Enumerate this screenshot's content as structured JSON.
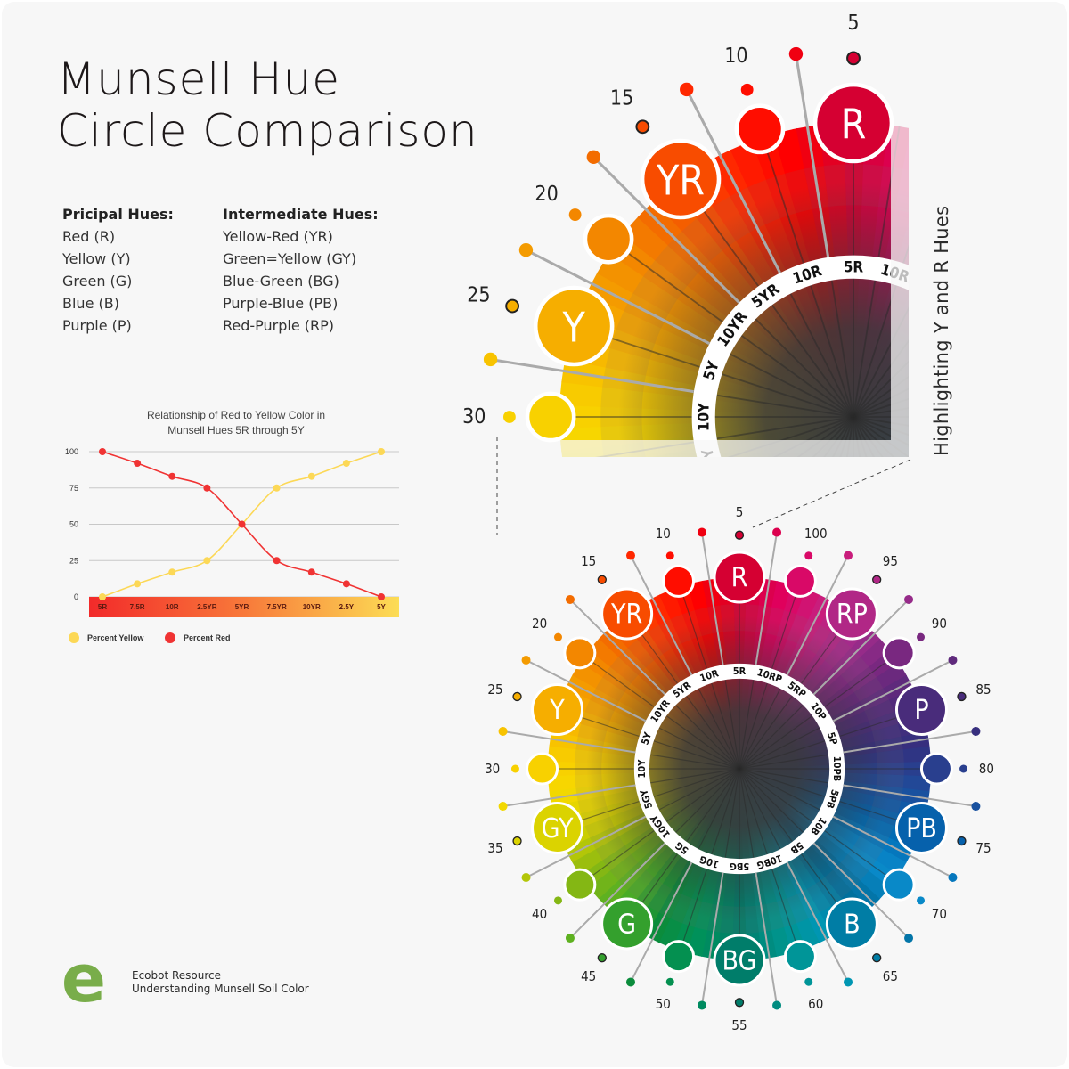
{
  "title": {
    "line1": "Munsell Hue",
    "line2": "Circle Comparison"
  },
  "principal_hues": {
    "heading": "Pricipal Hues:",
    "items": [
      "Red (R)",
      "Yellow (Y)",
      "Green (G)",
      "Blue (B)",
      "Purple (P)"
    ]
  },
  "intermediate_hues": {
    "heading": "Intermediate Hues:",
    "items": [
      "Yellow-Red (YR)",
      "Green=Yellow (GY)",
      "Blue-Green (BG)",
      "Purple-Blue (PB)",
      "Red-Purple (RP)"
    ]
  },
  "side_caption": "Highlighting Y and R Hues",
  "footer": {
    "line1": "Ecobot Resource",
    "line2": "Understanding Munsell Soil Color",
    "logo_letter": "e",
    "logo_color": "#79ad4a"
  },
  "wheel": {
    "major_hues": [
      "R",
      "RP",
      "P",
      "PB",
      "B",
      "BG",
      "G",
      "GY",
      "Y",
      "YR"
    ],
    "major_hue_numbers": [
      5,
      95,
      85,
      75,
      65,
      55,
      45,
      35,
      25,
      15
    ],
    "intermediate_numbers": [
      100,
      90,
      80,
      70,
      60,
      50,
      40,
      30,
      20,
      10
    ],
    "ring_labels_clockwise_from_top": [
      "5R",
      "10RP",
      "5RP",
      "10P",
      "5P",
      "10PB",
      "5PB",
      "10B",
      "5B",
      "10BG",
      "5BG",
      "10G",
      "5G",
      "10GY",
      "5GY",
      "10Y",
      "5Y",
      "10YR",
      "5YR",
      "10R"
    ],
    "hue_colors_clockwise_from_top": [
      "#d50032",
      "#e0005d",
      "#c81f7e",
      "#a12c8c",
      "#74287f",
      "#4e2b7a",
      "#33307f",
      "#1e4d9c",
      "#0066b0",
      "#0a8ccd",
      "#006d9b",
      "#0096b4",
      "#00948c",
      "#007d6a",
      "#00925a",
      "#0c8c3a",
      "#4fae24",
      "#8ab812",
      "#d4d100",
      "#f7d900",
      "#f8c800",
      "#f5a800",
      "#f38b00",
      "#f36200",
      "#ff2a00",
      "#ff0000"
    ]
  },
  "chart_data": {
    "type": "line",
    "title": "Relationship of Red to Yellow Color in Munsell Hues 5R through 5Y",
    "title_lines": [
      "Relationship of Red to Yellow Color in",
      "Munsell Hues 5R through 5Y"
    ],
    "categories": [
      "5R",
      "7.5R",
      "10R",
      "2.5YR",
      "5YR",
      "7.5YR",
      "10YR",
      "2.5Y",
      "5Y"
    ],
    "series": [
      {
        "name": "Percent Yellow",
        "color": "#fcd856",
        "values": [
          0,
          9,
          17,
          25,
          50,
          75,
          83,
          92,
          100
        ]
      },
      {
        "name": "Percent Red",
        "color": "#f03333",
        "values": [
          100,
          92,
          83,
          75,
          50,
          25,
          17,
          9,
          0
        ]
      }
    ],
    "yticks": [
      0,
      25,
      50,
      75,
      100
    ],
    "ylim": [
      0,
      100
    ],
    "xlabel": "",
    "ylabel": "",
    "grid": true,
    "legend": "bottom-left"
  }
}
